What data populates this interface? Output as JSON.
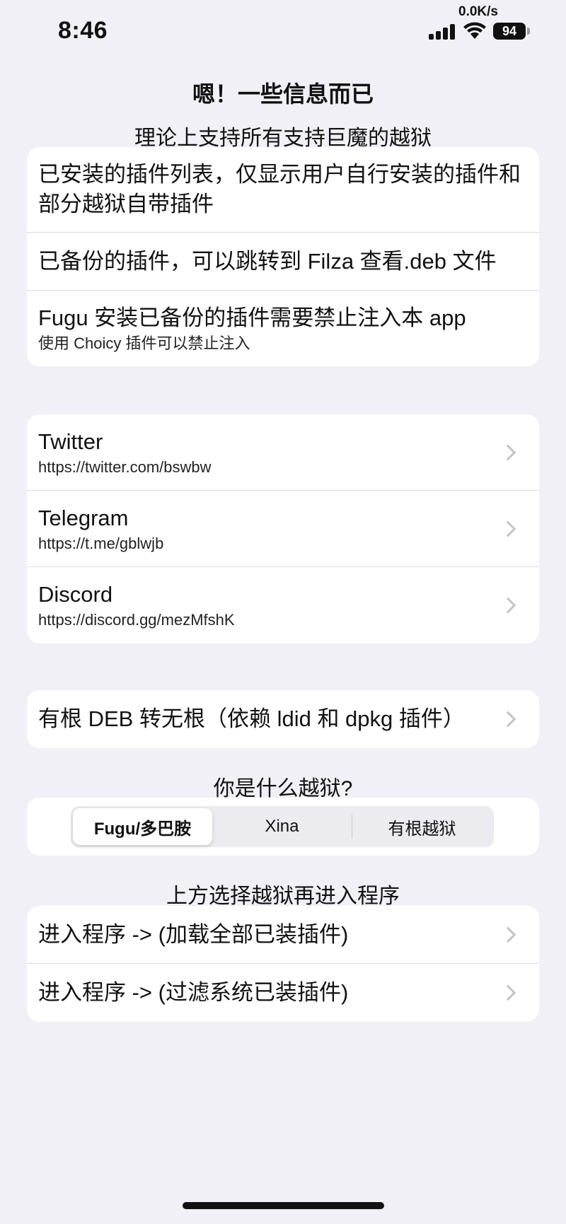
{
  "status_bar": {
    "time": "8:46",
    "net_speed": "0.0K/s",
    "battery": "94"
  },
  "header": {
    "title": "嗯！一些信息而已",
    "subtitle": "理论上支持所有支持巨魔的越狱"
  },
  "info_section": {
    "rows": [
      {
        "title": "已安装的插件列表，仅显示用户自行安装的插件和部分越狱自带插件"
      },
      {
        "title": "已备份的插件，可以跳转到 Filza 查看.deb 文件"
      },
      {
        "title": "Fugu 安装已备份的插件需要禁止注入本 app",
        "subtitle": "使用 Choicy 插件可以禁止注入"
      }
    ]
  },
  "links_section": {
    "rows": [
      {
        "title": "Twitter",
        "subtitle": "https://twitter.com/bswbw"
      },
      {
        "title": "Telegram",
        "subtitle": "https://t.me/gblwjb"
      },
      {
        "title": "Discord",
        "subtitle": "https://discord.gg/mezMfshK"
      }
    ]
  },
  "convert_section": {
    "label": "有根 DEB 转无根（依赖 ldid 和 dpkg 插件）"
  },
  "jailbreak_section": {
    "header": "你是什么越狱?",
    "options": [
      "Fugu/多巴胺",
      "Xina",
      "有根越狱"
    ],
    "selected": "Fugu/多巴胺"
  },
  "enter_section": {
    "header": "上方选择越狱再进入程序",
    "rows": [
      {
        "title": "进入程序 -> (加载全部已装插件)"
      },
      {
        "title": "进入程序 -> (过滤系统已装插件)"
      }
    ]
  }
}
